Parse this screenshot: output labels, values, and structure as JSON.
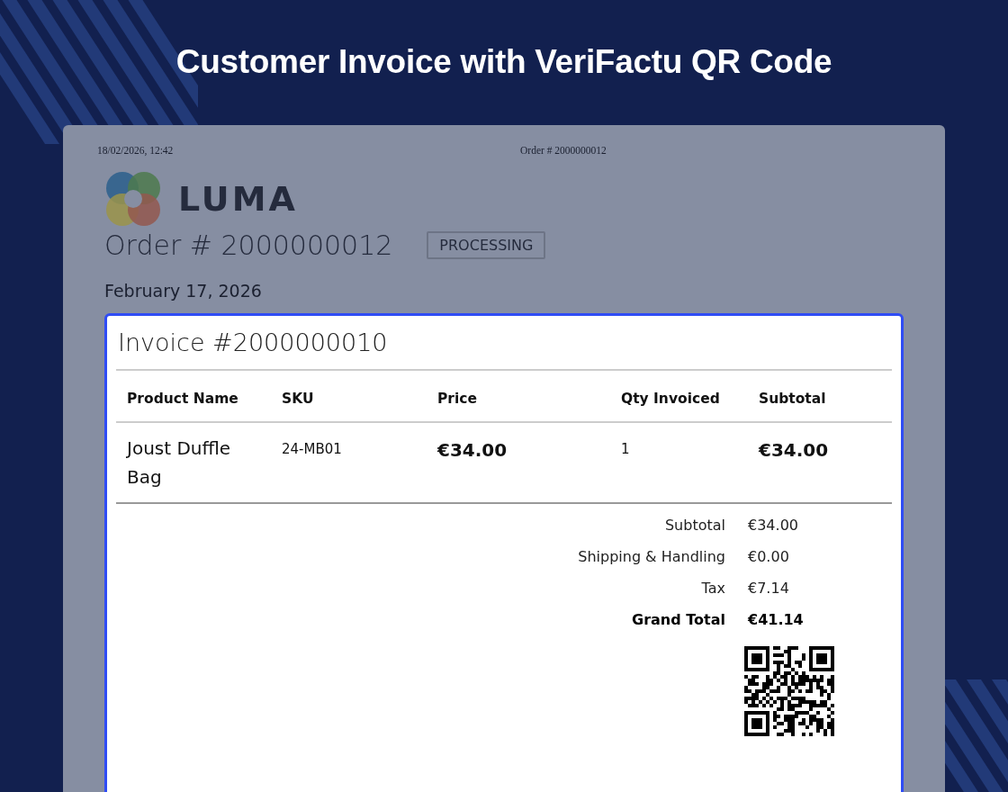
{
  "page_title": "Customer Invoice with VeriFactu QR Code",
  "print_header": {
    "date": "18/02/2026, 12:42",
    "title": "Order # 2000000012"
  },
  "logo": {
    "text": "LUMA"
  },
  "order": {
    "title": "Order # 2000000012",
    "status": "PROCESSING",
    "date": "February 17, 2026"
  },
  "invoice": {
    "title": "Invoice #2000000010",
    "columns": [
      "Product Name",
      "SKU",
      "Price",
      "Qty Invoiced",
      "Subtotal"
    ],
    "rows": [
      {
        "product_name": "Joust Duffle Bag",
        "sku": "24-MB01",
        "price": "€34.00",
        "qty_invoiced": "1",
        "subtotal": "€34.00"
      }
    ],
    "totals": [
      {
        "label": "Subtotal",
        "value": "€34.00",
        "kind": "normal"
      },
      {
        "label": "Shipping & Handling",
        "value": "€0.00",
        "kind": "normal"
      },
      {
        "label": "Tax",
        "value": "€7.14",
        "kind": "normal"
      },
      {
        "label": "Grand Total",
        "value": "€41.14",
        "kind": "grand"
      }
    ]
  }
}
